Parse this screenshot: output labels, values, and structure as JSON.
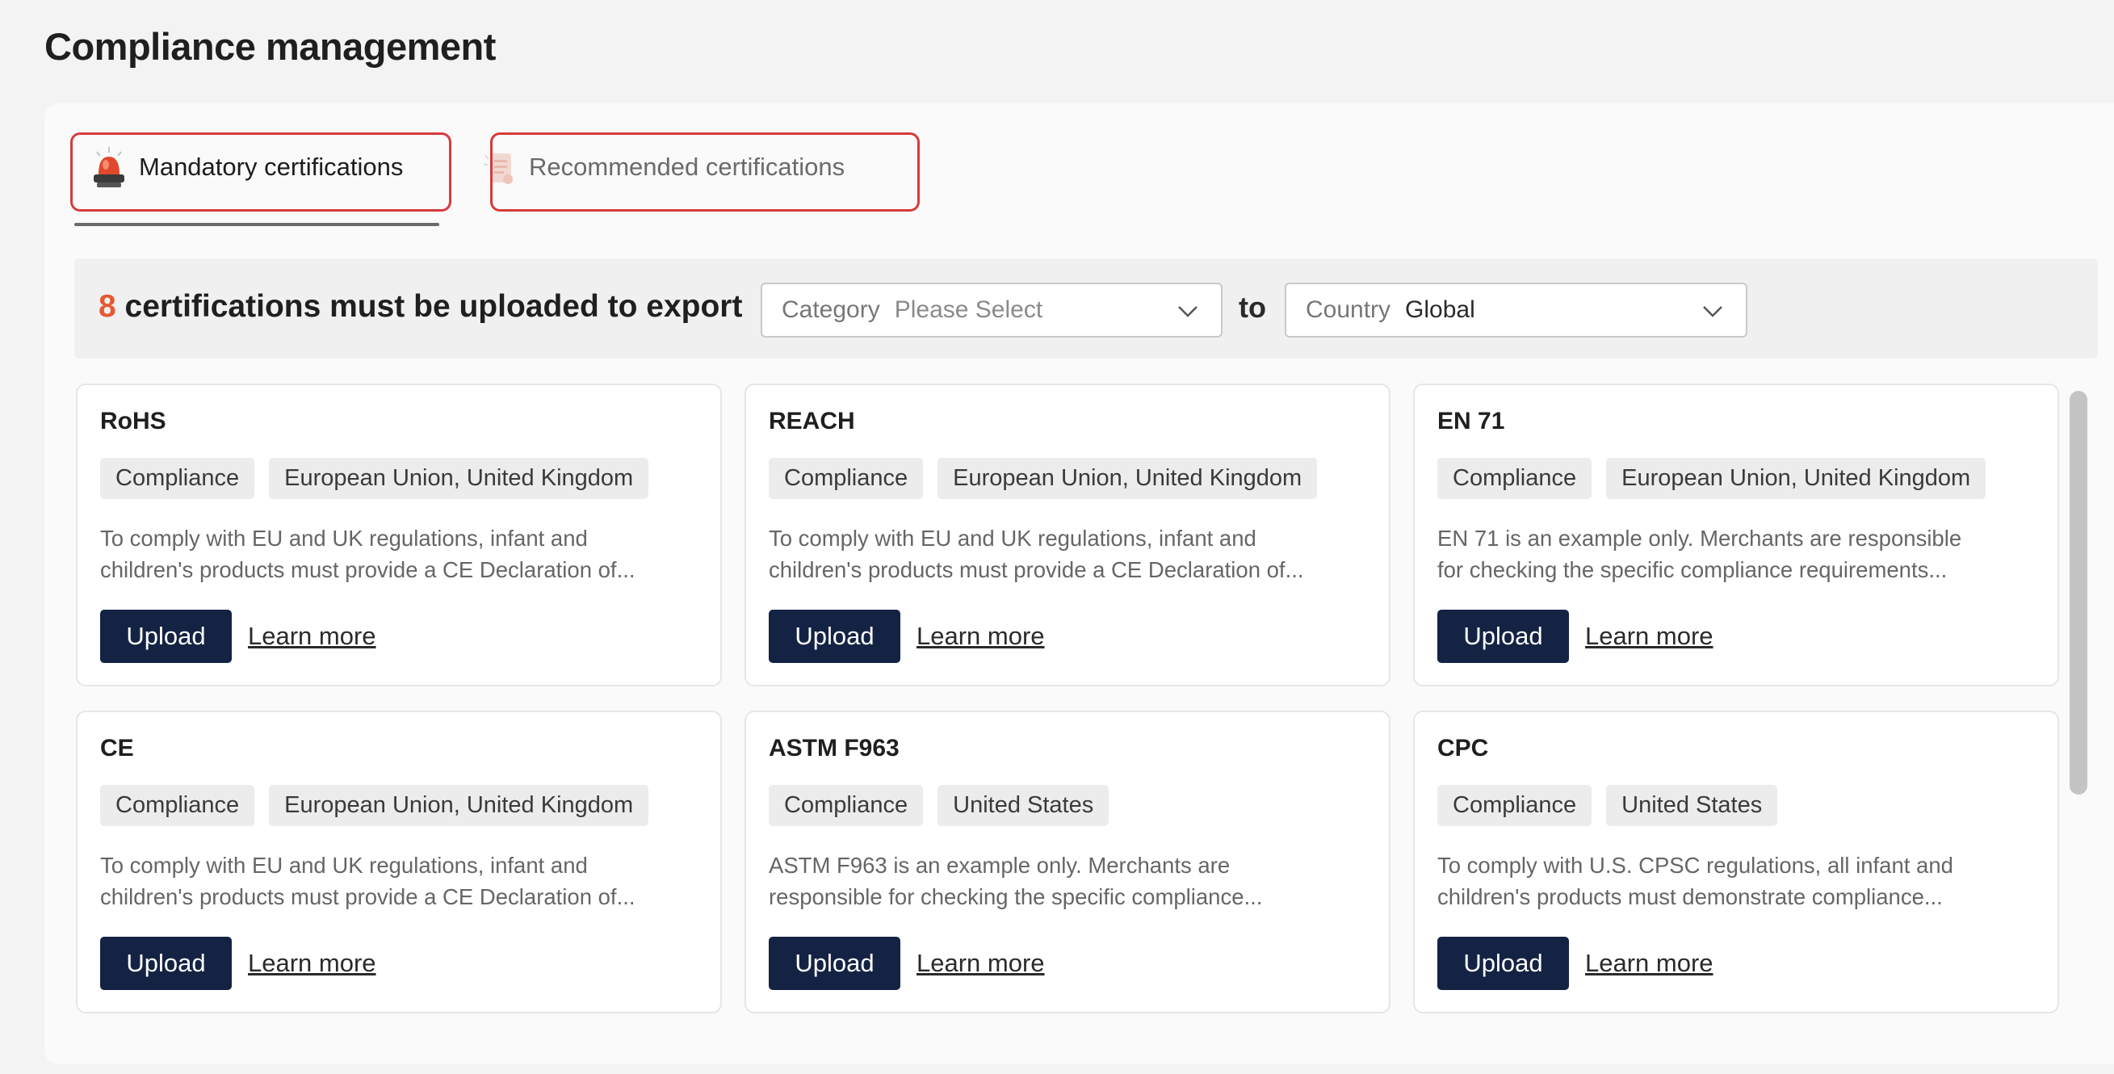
{
  "page": {
    "title": "Compliance management"
  },
  "tabs": [
    {
      "label": "Mandatory certifications",
      "icon": "alarm-siren-icon",
      "active": true
    },
    {
      "label": "Recommended certifications",
      "icon": "document-icon",
      "active": false
    }
  ],
  "filter": {
    "count": "8",
    "headline_text": " certifications must be uploaded to export",
    "category": {
      "label": "Category",
      "value": "Please Select"
    },
    "to_label": "to",
    "country": {
      "label": "Country",
      "value": "Global"
    }
  },
  "cards": [
    {
      "title": "RoHS",
      "tags": [
        "Compliance",
        "European Union, United Kingdom"
      ],
      "desc_line1": "To comply with EU and UK regulations, infant and",
      "desc_line2": "children's products must provide a CE Declaration of...",
      "upload": "Upload",
      "learn": "Learn more"
    },
    {
      "title": "REACH",
      "tags": [
        "Compliance",
        "European Union, United Kingdom"
      ],
      "desc_line1": "To comply with EU and UK regulations, infant and",
      "desc_line2": "children's products must provide a CE Declaration of...",
      "upload": "Upload",
      "learn": "Learn more"
    },
    {
      "title": "EN 71",
      "tags": [
        "Compliance",
        "European Union, United Kingdom"
      ],
      "desc_line1": "EN 71 is an example only. Merchants are responsible",
      "desc_line2": "for checking the specific compliance requirements...",
      "upload": "Upload",
      "learn": "Learn more"
    },
    {
      "title": "CE",
      "tags": [
        "Compliance",
        "European Union, United Kingdom"
      ],
      "desc_line1": "To comply with EU and UK regulations, infant and",
      "desc_line2": "children's products must provide a CE Declaration of...",
      "upload": "Upload",
      "learn": "Learn more"
    },
    {
      "title": "ASTM F963",
      "tags": [
        "Compliance",
        "United States"
      ],
      "desc_line1": "ASTM F963 is an example only. Merchants are",
      "desc_line2": "responsible for checking the specific compliance...",
      "upload": "Upload",
      "learn": "Learn more"
    },
    {
      "title": "CPC",
      "tags": [
        "Compliance",
        "United States"
      ],
      "desc_line1": "To comply with U.S. CPSC regulations, all infant and",
      "desc_line2": "children's products must demonstrate compliance...",
      "upload": "Upload",
      "learn": "Learn more"
    }
  ],
  "colors": {
    "accent_count": "#e45a33",
    "button_bg": "#142343",
    "highlight_border": "#d63b3b"
  }
}
